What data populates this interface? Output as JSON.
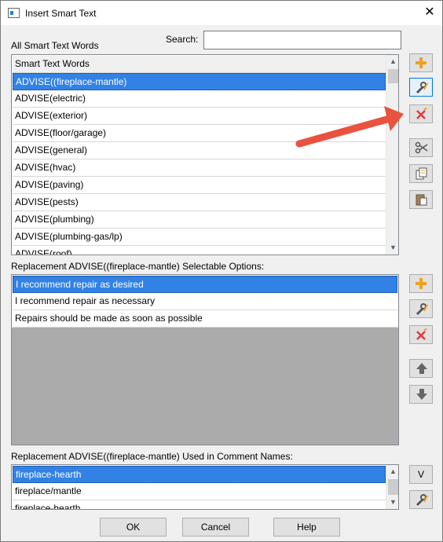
{
  "window": {
    "title": "Insert Smart Text",
    "close": "✕"
  },
  "search": {
    "label": "Search:",
    "value": "",
    "placeholder": ""
  },
  "words": {
    "label": "All Smart Text Words",
    "header": "Smart Text Words",
    "items": [
      "ADVISE((fireplace-mantle)",
      "ADVISE(electric)",
      "ADVISE(exterior)",
      "ADVISE(floor/garage)",
      "ADVISE(general)",
      "ADVISE(hvac)",
      "ADVISE(paving)",
      "ADVISE(pests)",
      "ADVISE(plumbing)",
      "ADVISE(plumbing-gas/lp)",
      "ADVISE(roof)"
    ],
    "selected_index": 0
  },
  "options": {
    "label": "Replacement ADVISE((fireplace-mantle) Selectable Options:",
    "items": [
      "I recommend repair as desired",
      "I recommend repair as necessary",
      "Repairs should be made as soon as possible"
    ],
    "selected_index": 0
  },
  "comments": {
    "label": "Replacement ADVISE((fireplace-mantle) Used in Comment Names:",
    "items": [
      "fireplace-hearth",
      "fireplace/mantle",
      "fireplace-hearth"
    ],
    "selected_index": 0,
    "v_button": "V"
  },
  "footer": {
    "ok": "OK",
    "cancel": "Cancel",
    "help": "Help"
  },
  "colors": {
    "selection": "#3282e6",
    "annotation_arrow": "#e8523e",
    "add_icon": "#f0a020",
    "delete_icon": "#e03c3c"
  },
  "icons": {
    "words_tools": [
      "add-icon",
      "edit-icon",
      "delete-icon",
      "cut-icon",
      "copy-icon",
      "paste-icon"
    ],
    "options_tools": [
      "add-icon",
      "edit-icon",
      "delete-icon",
      "move-up-icon",
      "move-down-icon"
    ],
    "comments_tools": [
      "edit-icon"
    ]
  }
}
